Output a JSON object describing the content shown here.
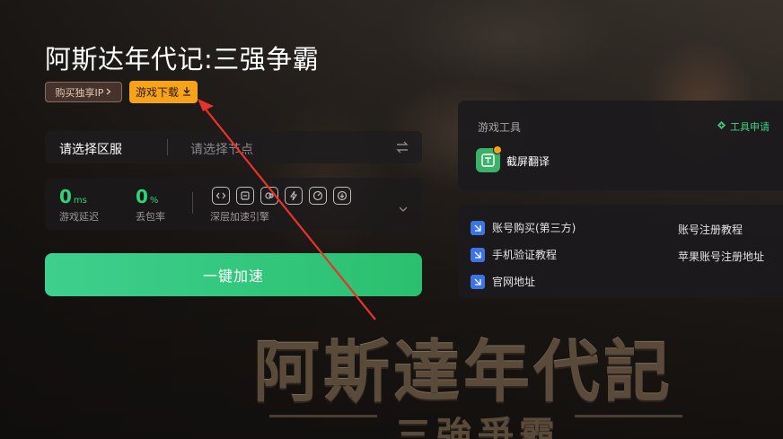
{
  "header": {
    "game_title": "阿斯达年代记:三强争霸",
    "buy_ip_label": "购买独享IP",
    "download_label": "游戏下载"
  },
  "selector": {
    "region_label": "请选择区服",
    "node_placeholder": "请选择节点"
  },
  "stats": {
    "latency_value": "0",
    "latency_unit": "ms",
    "latency_label": "游戏延迟",
    "loss_value": "0",
    "loss_unit": "%",
    "loss_label": "丢包率",
    "engine_label": "深层加速引擎"
  },
  "accelerate_label": "一键加速",
  "tools": {
    "heading": "游戏工具",
    "apply_label": "工具申请",
    "screen_translate_label": "截屏翻译"
  },
  "links": {
    "account_purchase": "账号购买(第三方)",
    "phone_verify_tutorial": "手机验证教程",
    "official_site": "官网地址",
    "account_register_tutorial": "账号注册教程",
    "apple_register_address": "苹果账号注册地址"
  },
  "art": {
    "title": "阿斯達年代記",
    "subtitle": "三強爭霸"
  },
  "colors": {
    "accent_green": "#2fd37a",
    "download_orange": "#f7a21b",
    "link_icon_blue": "#3d74e3",
    "annotation_red": "#e8332a"
  }
}
